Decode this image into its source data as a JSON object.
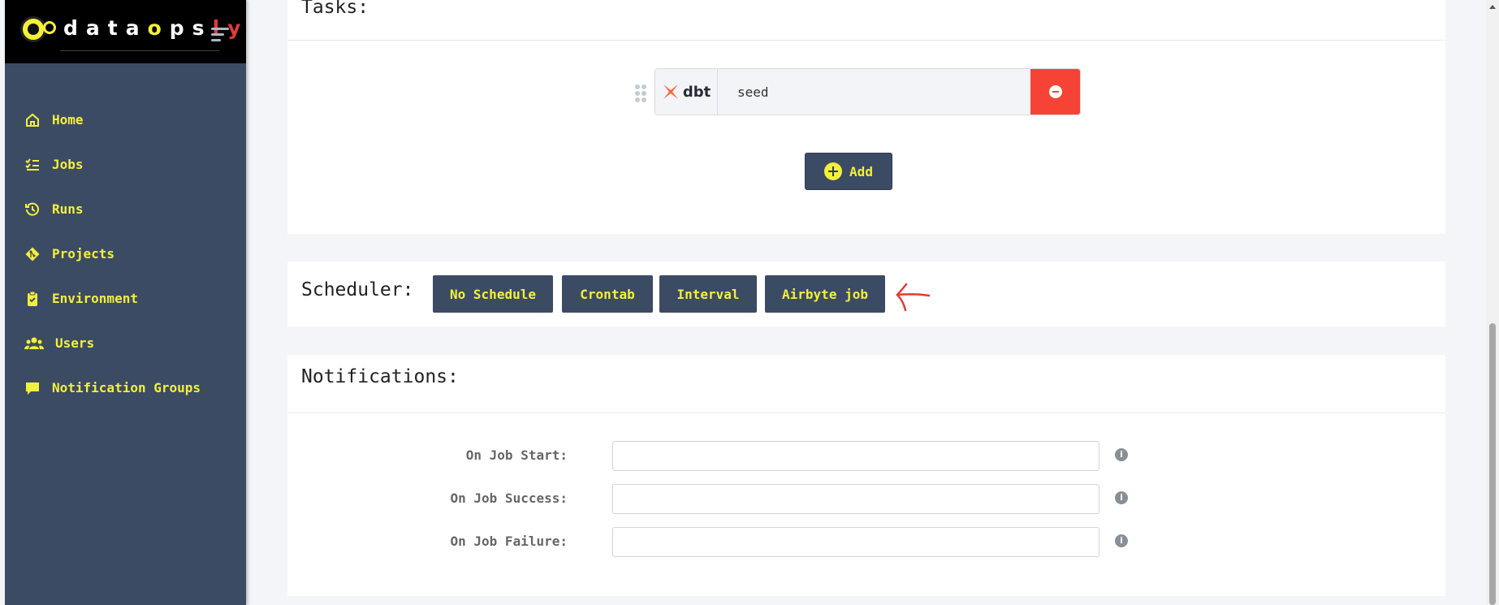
{
  "brand": {
    "name_d": "data",
    "name_o": "o",
    "name_ps": "ps",
    "name_ly": "ly"
  },
  "sidebar": {
    "items": [
      {
        "label": "Home",
        "icon": "home-icon"
      },
      {
        "label": "Jobs",
        "icon": "list-check-icon"
      },
      {
        "label": "Runs",
        "icon": "history-icon"
      },
      {
        "label": "Projects",
        "icon": "git-icon"
      },
      {
        "label": "Environment",
        "icon": "clipboard-check-icon"
      },
      {
        "label": "Users",
        "icon": "users-icon"
      },
      {
        "label": "Notification Groups",
        "icon": "message-icon"
      }
    ]
  },
  "tasks": {
    "title": "Tasks:",
    "items": [
      {
        "logo": "dbt",
        "value": "seed"
      }
    ],
    "add_label": "Add"
  },
  "scheduler": {
    "label": "Scheduler:",
    "options": [
      "No Schedule",
      "Crontab",
      "Interval",
      "Airbyte job"
    ]
  },
  "notifications": {
    "title": "Notifications:",
    "fields": [
      {
        "label": "On Job Start:",
        "value": ""
      },
      {
        "label": "On Job Success:",
        "value": ""
      },
      {
        "label": "On Job Failure:",
        "value": ""
      }
    ],
    "info_glyph": "i"
  },
  "colors": {
    "sidebar": "#3c4b64",
    "accent": "#f3f03a",
    "danger": "#f54336",
    "annotation": "#e53935"
  }
}
